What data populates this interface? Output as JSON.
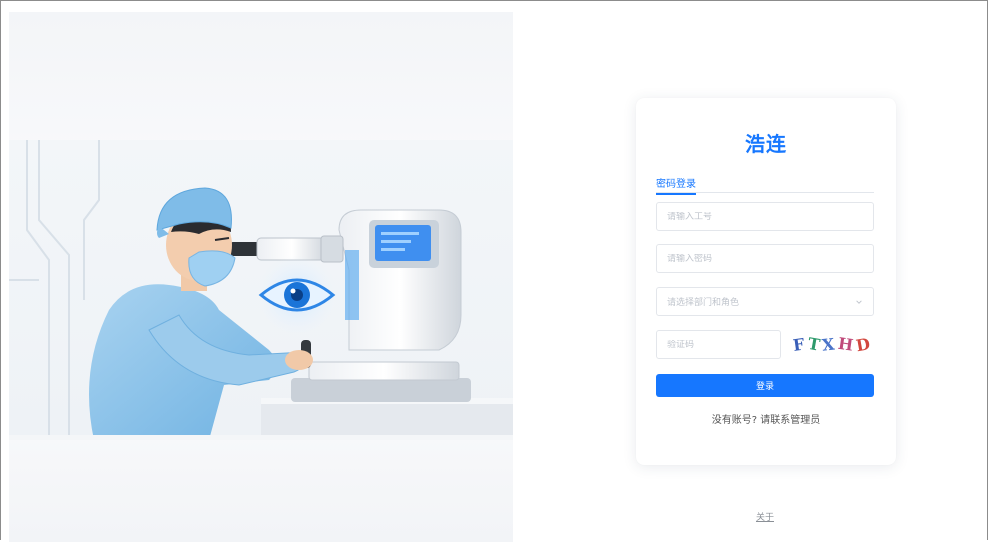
{
  "app": {
    "title": "浩连"
  },
  "login": {
    "tab_password": "密码登录",
    "employee_id_placeholder": "请输入工号",
    "password_placeholder": "请输入密码",
    "department_placeholder": "请选择部门和角色",
    "captcha_placeholder": "验证码",
    "captcha_chars": [
      "F",
      "T",
      "X",
      "H",
      "D"
    ],
    "submit_label": "登录",
    "no_account_text": "没有账号? 请联系管理员"
  },
  "footer": {
    "about_label": "关于"
  },
  "colors": {
    "accent": "#1677ff",
    "card_bg": "#ffffff",
    "page_bg": "#ffffff"
  },
  "icons": {
    "select_arrow": "chevron-down-icon"
  }
}
